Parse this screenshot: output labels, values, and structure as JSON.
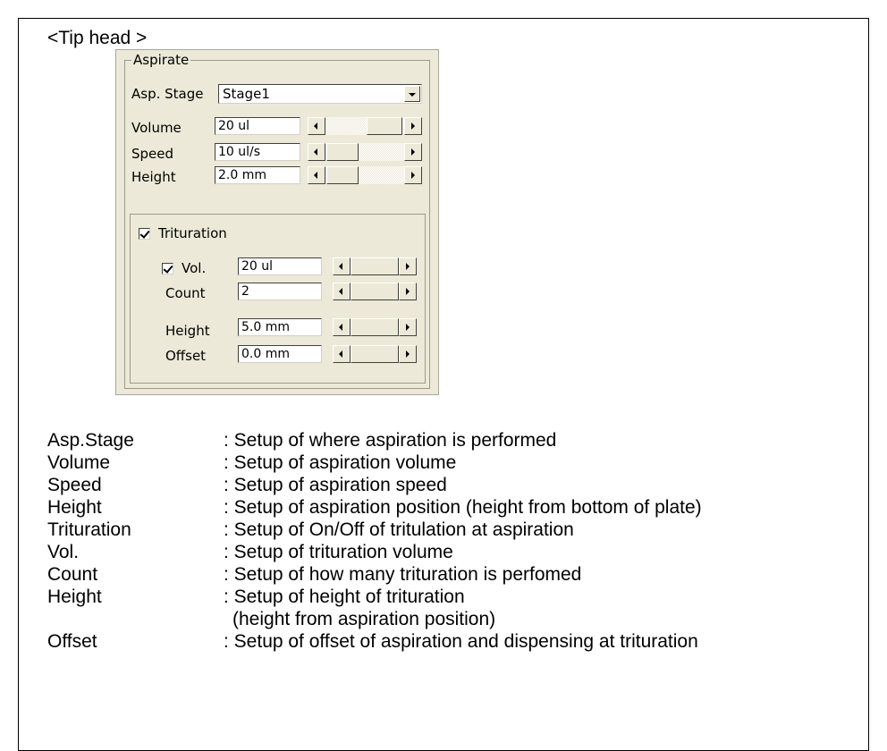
{
  "heading": "<Tip head >",
  "aspirate": {
    "group_label": "Aspirate",
    "stage_label": "Asp. Stage",
    "stage_value": "Stage1",
    "volume_label": "Volume",
    "volume_value": "20 ul",
    "speed_label": "Speed",
    "speed_value": "10 ul/s",
    "height_label": "Height",
    "height_value": "2.0 mm"
  },
  "trituration": {
    "checkbox_label": "Trituration",
    "checked": true,
    "vol_label": "Vol.",
    "vol_checked": true,
    "vol_value": "20 ul",
    "count_label": "Count",
    "count_value": "2",
    "height_label": "Height",
    "height_value": "5.0 mm",
    "offset_label": "Offset",
    "offset_value": "0.0 mm"
  },
  "descriptions": [
    {
      "term": "Asp.Stage",
      "def": ": Setup of where aspiration is performed"
    },
    {
      "term": "Volume",
      "def": ": Setup of aspiration volume"
    },
    {
      "term": "Speed",
      "def": ": Setup of aspiration speed"
    },
    {
      "term": "Height",
      "def": ": Setup of aspiration position (height from bottom of plate)"
    },
    {
      "term": "Trituration",
      "def": ": Setup of On/Off of tritulation at aspiration"
    },
    {
      "term": "Vol.",
      "def": ": Setup of trituration volume"
    },
    {
      "term": "Count",
      "def": ": Setup of how many trituration is perfomed"
    },
    {
      "term": "Height",
      "def": ": Setup of height of trituration"
    },
    {
      "term": "",
      "def": "(height from aspiration position)"
    },
    {
      "term": "Offset",
      "def": ": Setup of offset of aspiration and dispensing at trituration"
    }
  ]
}
